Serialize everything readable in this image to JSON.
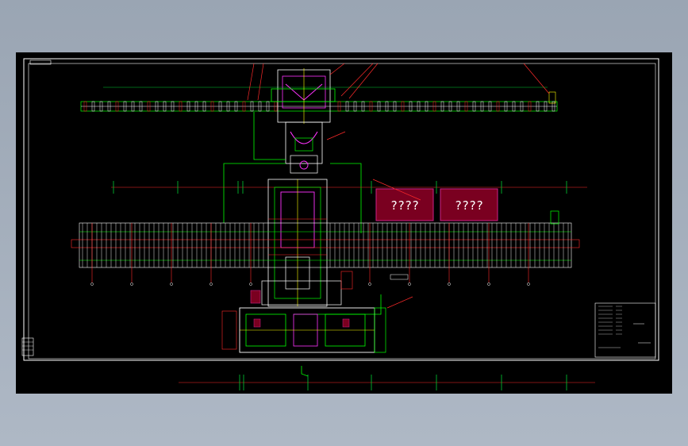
{
  "drawing": {
    "block_labels": [
      "????",
      "????"
    ],
    "colors": {
      "background": "#000000",
      "frame": "#ffffff",
      "conveyor": "#ffffff",
      "roller_accent": "#ff2a2a",
      "structure": "#00ff00",
      "machine": "#ff33ff",
      "guide": "#ffff00",
      "dimension": "#00cc33",
      "block_fill": "#7a0020",
      "block_border": "#cc2288"
    },
    "icons": [
      "balloon-leader-icon",
      "dimension-tick-icon"
    ]
  }
}
